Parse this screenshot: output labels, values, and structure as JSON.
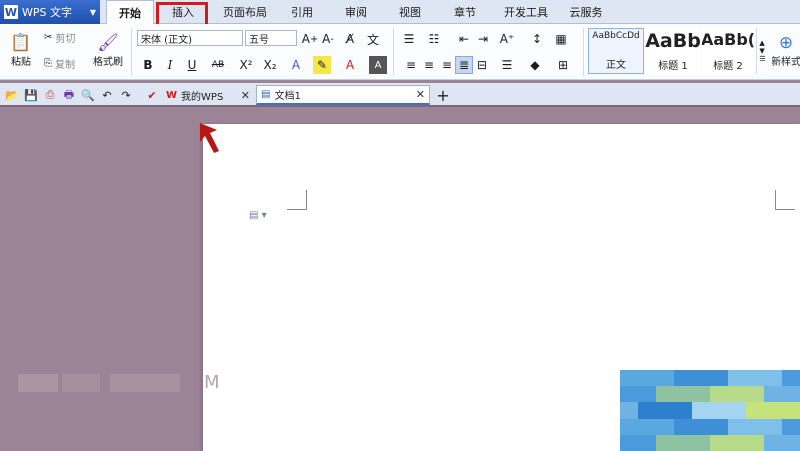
{
  "app": {
    "name": "WPS 文字",
    "logo_letter": "W"
  },
  "tabs": [
    {
      "label": "开始",
      "active": true
    },
    {
      "label": "插入",
      "highlighted": true
    },
    {
      "label": "页面布局"
    },
    {
      "label": "引用"
    },
    {
      "label": "审阅"
    },
    {
      "label": "视图"
    },
    {
      "label": "章节"
    },
    {
      "label": "开发工具"
    },
    {
      "label": "云服务"
    }
  ],
  "ribbon": {
    "paste": "粘贴",
    "cut": "剪切",
    "copy": "复制",
    "format_painter": "格式刷",
    "font_name": "宋体 (正文)",
    "font_size": "五号",
    "styles": [
      {
        "sample": "AaBbCcDd",
        "caption": "正文"
      },
      {
        "sample": "AaBb",
        "caption": "标题 1"
      },
      {
        "sample": "AaBb(",
        "caption": "标题 2"
      }
    ],
    "new_style": "新样式"
  },
  "doc_tabs": [
    {
      "label": "我的WPS"
    },
    {
      "label": "文档1",
      "active": true
    }
  ],
  "watermark_text": "M",
  "colors": {
    "highlight": "#d21c1c",
    "accent": "#2456b8",
    "background": "#9a8496"
  }
}
